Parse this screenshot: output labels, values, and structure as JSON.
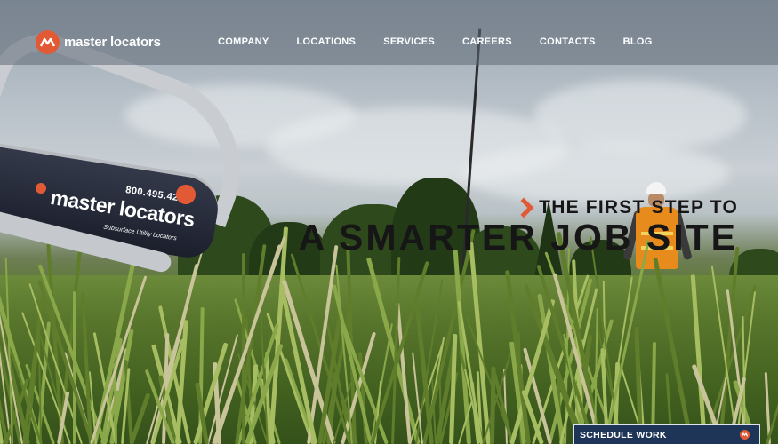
{
  "brand": {
    "name": "master locators",
    "accent_color": "#e25a35",
    "logo_icon": "brand-logo-icon"
  },
  "nav": {
    "items": [
      {
        "label": "COMPANY"
      },
      {
        "label": "LOCATIONS"
      },
      {
        "label": "SERVICES"
      },
      {
        "label": "CAREERS"
      },
      {
        "label": "CONTACTS"
      },
      {
        "label": "BLOG"
      }
    ]
  },
  "hero": {
    "headline_line1": "THE FIRST STEP TO",
    "headline_line2": "A SMARTER JOB SITE",
    "device": {
      "phone": "800.495.4248",
      "brand": "master locators",
      "tagline": "Subsurface Utility Locators"
    }
  },
  "schedule": {
    "label": "SCHEDULE WORK",
    "icon": "brand-logo-icon",
    "bar_color": "#1f3558"
  }
}
